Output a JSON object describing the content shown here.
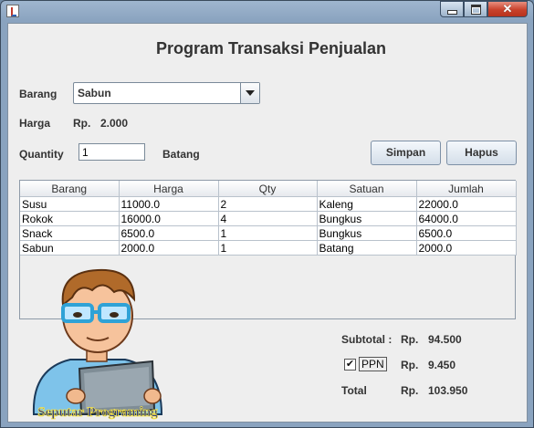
{
  "window": {
    "app_icon": "java-icon"
  },
  "form": {
    "title": "Program Transaksi Penjualan",
    "barang_label": "Barang",
    "barang_value": "Sabun",
    "harga_label": "Harga",
    "harga_currency": "Rp.",
    "harga_value": "2.000",
    "quantity_label": "Quantity",
    "quantity_value": "1",
    "unit_label": "Batang",
    "simpan_label": "Simpan",
    "hapus_label": "Hapus"
  },
  "table": {
    "columns": [
      "Barang",
      "Harga",
      "Qty",
      "Satuan",
      "Jumlah"
    ],
    "rows": [
      [
        "Susu",
        "11000.0",
        "2",
        "Kaleng",
        "22000.0"
      ],
      [
        "Rokok",
        "16000.0",
        "4",
        "Bungkus",
        "64000.0"
      ],
      [
        "Snack",
        "6500.0",
        "1",
        "Bungkus",
        "6500.0"
      ],
      [
        "Sabun",
        "2000.0",
        "1",
        "Batang",
        "2000.0"
      ]
    ]
  },
  "summary": {
    "subtotal_label": "Subtotal :",
    "subtotal_currency": "Rp.",
    "subtotal_value": "94.500",
    "ppn_checked": true,
    "ppn_check_glyph": "✔",
    "ppn_label": "PPN",
    "ppn_currency": "Rp.",
    "ppn_value": "9.450",
    "total_label": "Total",
    "total_currency": "Rp.",
    "total_value": "103.950"
  },
  "watermark": {
    "text": "Seputar Programing"
  },
  "colors": {
    "title_close": "#c8412b",
    "checkbox_mark": "#111111"
  }
}
